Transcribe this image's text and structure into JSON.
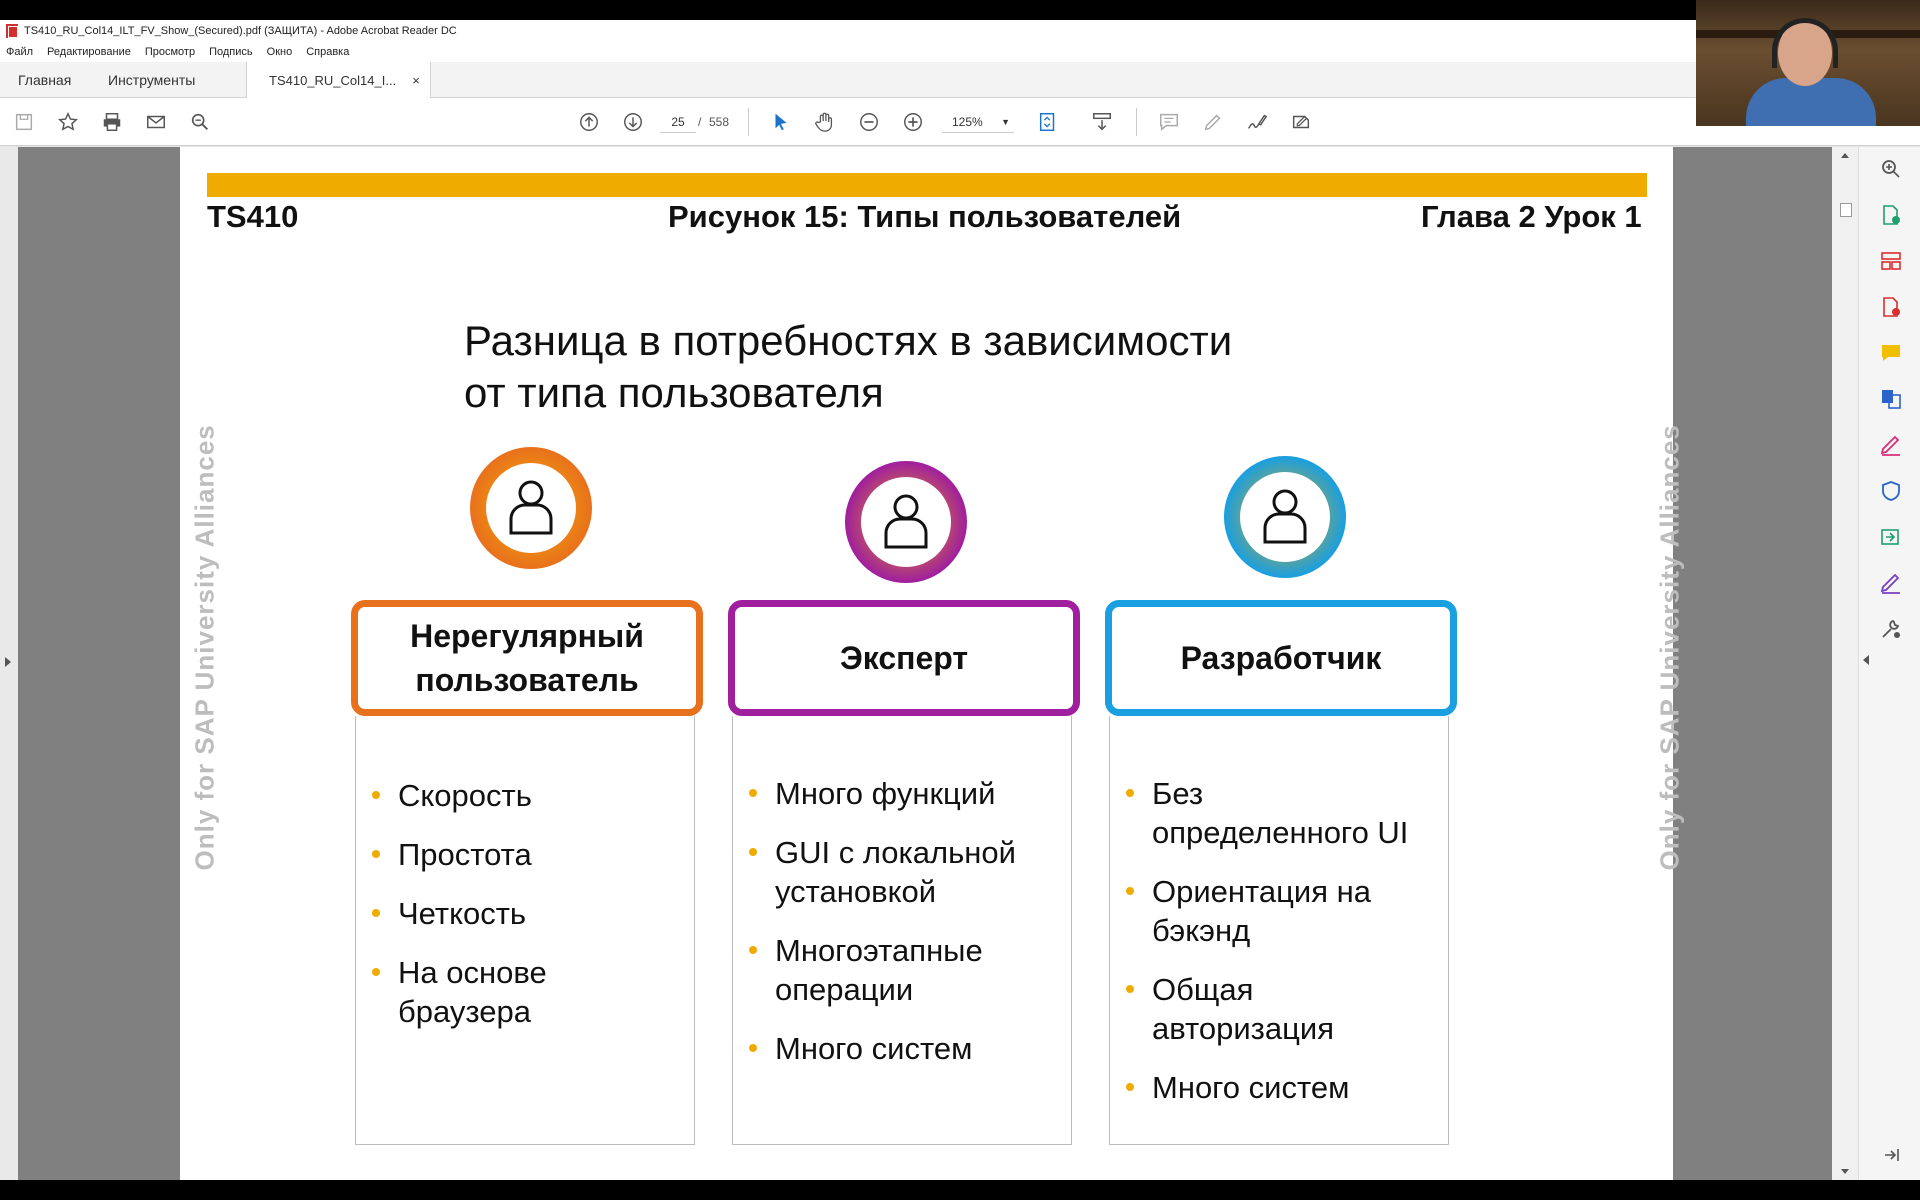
{
  "window": {
    "title": "TS410_RU_Col14_ILT_FV_Show_(Secured).pdf (ЗАЩИТА) - Adobe Acrobat Reader DC"
  },
  "menu": [
    "Файл",
    "Редактирование",
    "Просмотр",
    "Подпись",
    "Окно",
    "Справка"
  ],
  "tabs": {
    "home": "Главная",
    "tools": "Инструменты",
    "document": "TS410_RU_Col14_I...",
    "close": "×"
  },
  "toolbar": {
    "page_current": "25",
    "page_sep": "/",
    "page_total": "558",
    "zoom": "125%"
  },
  "slide": {
    "course": "TS410",
    "figure_title": "Рисунок 15: Типы пользователей",
    "chapter": "Глава 2 Урок 1",
    "watermark": "Only for SAP University Alliances",
    "subtitle_line1": "Разница в потребностях в зависимости",
    "subtitle_line2": "от типа пользователя",
    "columns": [
      {
        "title_line1": "Нерегулярный",
        "title_line2": "пользователь",
        "color": "#e8711d",
        "items": [
          "Скорость",
          "Простота",
          "Четкость",
          "На основе браузера"
        ]
      },
      {
        "title_line1": "Эксперт",
        "title_line2": "",
        "color": "#a01f9e",
        "items": [
          "Много функций",
          "GUI с локальной установкой",
          "Многоэтапные операции",
          "Много систем"
        ]
      },
      {
        "title_line1": "Разработчик",
        "title_line2": "",
        "color": "#1a9fe0",
        "items": [
          "Без определенного UI",
          "Ориентация на бэкэнд",
          "Общая авторизация",
          "Много систем"
        ]
      }
    ]
  },
  "colors": {
    "accent_yellow": "#f0ab00",
    "orange": "#e8711d",
    "purple": "#a01f9e",
    "blue": "#1a9fe0"
  },
  "icons": [
    "save-icon",
    "bookmark-star-icon",
    "print-icon",
    "email-icon",
    "search-icon",
    "page-up-icon",
    "page-down-icon",
    "select-cursor-icon",
    "hand-icon",
    "zoom-out-icon",
    "zoom-in-icon",
    "fit-page-icon",
    "scroll-mode-icon",
    "comment-icon",
    "highlight-icon",
    "sign-icon",
    "fill-sign-icon"
  ]
}
